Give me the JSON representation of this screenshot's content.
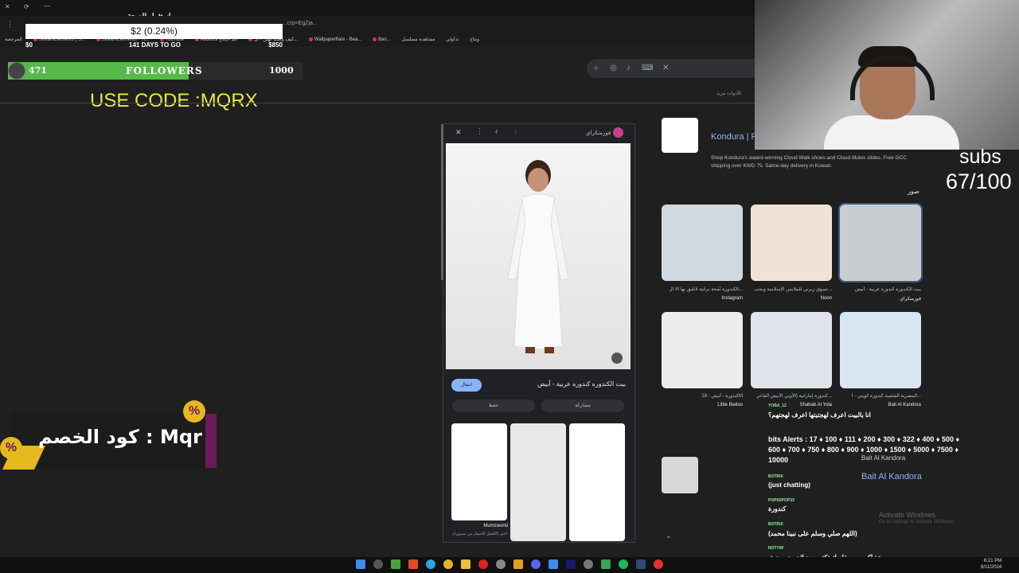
{
  "goal_overlay": {
    "title": "استثمار للصحة",
    "amount": "$2 (0.24%)",
    "start": "$0",
    "days": "141 DAYS TO GO",
    "target": "$850"
  },
  "browser": {
    "url_fragment": "...crp=EgZja...",
    "bookmarks": [
      "المرجعية",
      "StreamElements | S...",
      "StreamElements - Ti...",
      "YouTube",
      "AdBlock ائم الإبلاغ",
      "كيف وصلنا لهين - ال...",
      "Wallpaperflare - Bea...",
      "Ban...",
      "مشاهدة مسلسل",
      "تداولي",
      "ونتاج"
    ]
  },
  "followers": {
    "count": "471",
    "label": "FOLLOWERS",
    "goal": "1000",
    "progress": 0.471
  },
  "promo": {
    "use_code": "USE CODE :MQRX",
    "discount_text": "كود الخصم : Mqr",
    "percent_symbol": "%"
  },
  "search_nav": {
    "items": [
      "مزيد",
      "الأدوات"
    ]
  },
  "viewer": {
    "site": "فورمنكراي",
    "caption": "بيت الكندوره كندوره عربية - أبيض",
    "visit_label": "انتقال",
    "share_label": "مشاركة",
    "save_label": "حفظ",
    "thumb_source": "Mumzworld",
    "thumb_desc": "اختر بالأفضل الأسعار من ممزورلد..."
  },
  "result": {
    "title": "Kondura | F...",
    "description": "Shop Kondura's award-winning Cloud Walk shoes and Cloud Mules slides. Free GCC shipping over KWD 75. Same-day delivery in Kuwait.",
    "images_heading": "صور"
  },
  "image_grid": [
    {
      "caption": "الكندورة لمحة تراثية لاتليق بها الا ال...",
      "source": "Instagram"
    },
    {
      "caption": "تسوق زيرتي للملابس الإسلامية وبجب...",
      "source": "Noon"
    },
    {
      "caption": "بيت الكندورة كندورة عربية - أبيض",
      "source": "فورمنكراي"
    },
    {
      "caption": "كندورة - أبيض - 18M",
      "source": "Little Bedoo"
    },
    {
      "caption": "كندورة إماراتية (الأوبي الأبيض الفاخر...",
      "source": "Shabab Al Yola"
    },
    {
      "caption": "المصرية الشعبية كندورة كويتي - أ...",
      "source": "Bait Al Kandora"
    }
  ],
  "stream": {
    "subs_label": "subs",
    "subs_count": "67/100"
  },
  "chat": [
    {
      "user": "YOBA_12",
      "message": "انا بالبيت اعرف لهجتيتها اعرف لهجتهم؟"
    },
    {
      "user": "BOTRIX",
      "message": "(just chatting)"
    },
    {
      "user": "POPS5POP33",
      "message": "كندورة"
    },
    {
      "user": "BOTRIX",
      "message": "(اللهم صلي وسلم على نبينا محمد)"
    },
    {
      "user": "NOTY8F",
      "message": "بس خذ اكبر من مقاسك تكتين بعد لان يجي ضيق"
    }
  ],
  "bits_alerts": "bits Alerts : 17 ♦ 100 ♦ 111 ♦ 200 ♦ 300 ♦ 322 ♦ 400 ♦ 500 ♦ 600 ♦ 700 ♦ 750 ♦ 800 ♦ 900 ♦ 1000 ♦ 1500 ♦ 5000 ♦ 7500 ♦ 10000",
  "bait_overlay": {
    "small": "Bait Al Kandora",
    "big": "Bait Al Kandora"
  },
  "windows_watermark": {
    "title": "Activate Windows",
    "subtitle": "Go to Settings to activate Windows."
  },
  "clock": {
    "time": "6:21 PM",
    "date": "8/11/2024"
  },
  "colors": {
    "followers_fill": "#57b94a",
    "promo_yellow": "#e5b820",
    "link_blue": "#8ab4f8"
  }
}
